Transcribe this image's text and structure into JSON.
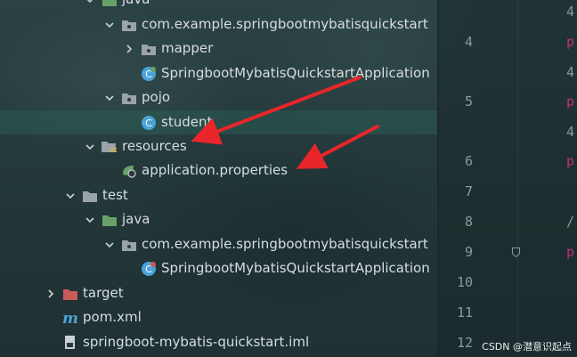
{
  "tree": {
    "java_main": "java",
    "pkg_main": "com.example.springbootmybatisquickstart",
    "mapper": "mapper",
    "app_main": "SpringbootMybatisQuickstartApplication",
    "pojo": "pojo",
    "student": "student",
    "resources": "resources",
    "app_props": "application.properties",
    "test": "test",
    "java_test": "java",
    "pkg_test": "com.example.springbootmybatisquickstart",
    "app_test": "SpringbootMybatisQuickstartApplication",
    "target": "target",
    "pom": "pom.xml",
    "iml": "springboot-mybatis-quickstart.iml"
  },
  "gutter": {
    "lines": [
      "4",
      "5",
      "6",
      "7",
      "8",
      "9",
      "10",
      "11",
      "12"
    ],
    "fragments": [
      "4",
      "p",
      "4",
      "p",
      "4",
      "p",
      "/",
      "p"
    ]
  },
  "watermark": "CSDN @潜意识起点",
  "colors": {
    "folder": "#9aa3a8",
    "source_folder": "#6aa06a",
    "class_icon": "#4aa3d8",
    "target_folder": "#c85a5a",
    "annotation_arrow": "#e8262a",
    "keyword_pink": "#c0307a"
  }
}
